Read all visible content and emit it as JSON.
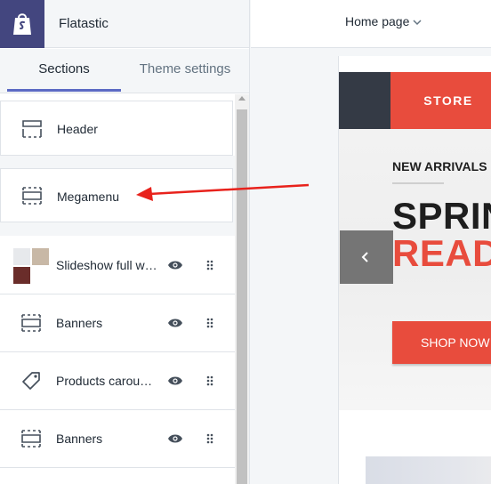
{
  "app": {
    "store_name": "Flatastic",
    "logo_icon": "shopify-bag-icon"
  },
  "tabs": [
    {
      "label": "Sections",
      "active": true
    },
    {
      "label": "Theme settings",
      "active": false
    }
  ],
  "sections": [
    {
      "label": "Header",
      "icon": "section-layout-icon"
    },
    {
      "label": "Megamenu",
      "icon": "section-layout-icon"
    }
  ],
  "rows": [
    {
      "label": "Slideshow full w…",
      "icon": "slideshow-thumbnail",
      "visible_icon": "eye-icon",
      "drag_icon": "drag-handle-icon"
    },
    {
      "label": "Banners",
      "icon": "section-layout-icon",
      "visible_icon": "eye-icon",
      "drag_icon": "drag-handle-icon"
    },
    {
      "label": "Products carou…",
      "icon": "tag-icon",
      "visible_icon": "eye-icon",
      "drag_icon": "drag-handle-icon"
    },
    {
      "label": "Banners",
      "icon": "section-layout-icon",
      "visible_icon": "eye-icon",
      "drag_icon": "drag-handle-icon"
    }
  ],
  "topbar": {
    "page_select": "Home page"
  },
  "preview": {
    "store_label": "STORE",
    "new_arrivals": "NEW ARRIVALS",
    "headline_1": "SPRIN",
    "headline_2": "READY",
    "shop_now": "SHOP NOW"
  },
  "colors": {
    "accent": "#5c6ac4",
    "logo_bg": "#43467f",
    "store_red": "#e84c3d",
    "store_dark": "#343a45",
    "annotation": "#e8221c"
  }
}
